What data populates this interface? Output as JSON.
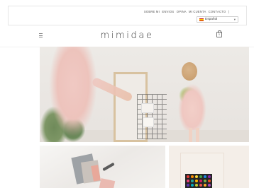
{
  "top_links": {
    "items": [
      "SOBRE MI",
      "ENVIOS",
      "OPINA",
      "MI CUENTA",
      "CONTACTO",
      "|"
    ]
  },
  "language": {
    "selected": "Español",
    "arrow": "▾"
  },
  "header": {
    "logo": "mimidae",
    "cart_count": "0"
  },
  "colors": {
    "text": "#333333",
    "border": "#e6e6e6"
  },
  "icons": [
    "hamburger-menu-icon",
    "shopping-bag-icon",
    "spain-flag-icon",
    "chevron-down-icon"
  ]
}
